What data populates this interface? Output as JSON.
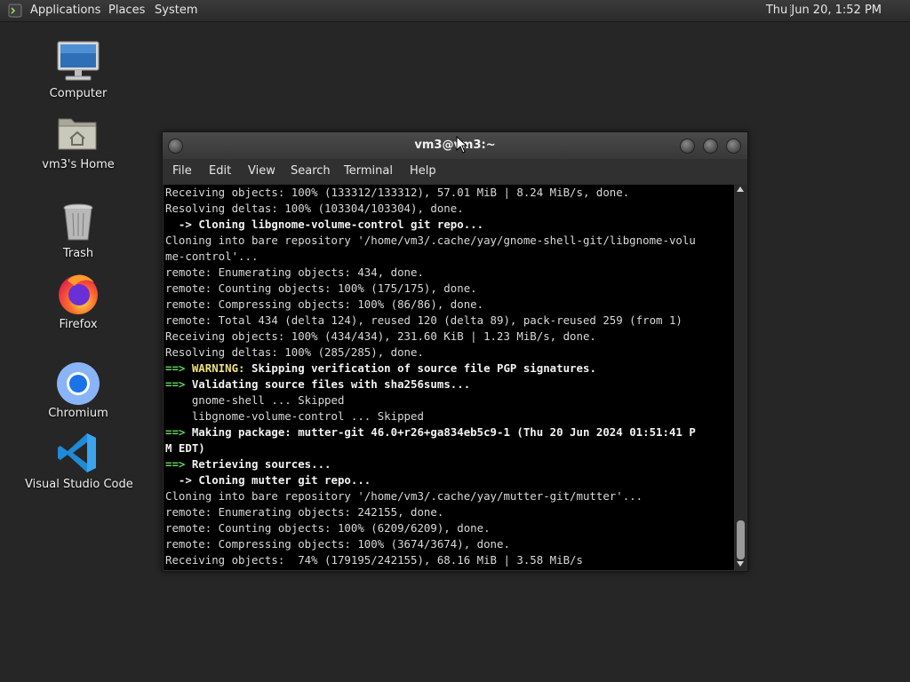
{
  "panel": {
    "applications": "Applications",
    "places": "Places",
    "system": "System",
    "clock": "Thu Jun 20,  1:52 PM"
  },
  "desktop": {
    "icons": [
      {
        "label": "Computer",
        "icon": "computer-icon"
      },
      {
        "label": "vm3's Home",
        "icon": "home-folder-icon"
      },
      {
        "label": "Trash",
        "icon": "trash-icon"
      },
      {
        "label": "Firefox",
        "icon": "firefox-icon"
      },
      {
        "label": "Chromium",
        "icon": "chromium-icon"
      },
      {
        "label": "Visual Studio Code",
        "icon": "vscode-icon"
      }
    ]
  },
  "terminal": {
    "title": "vm3@vm3:~",
    "menu": [
      "File",
      "Edit",
      "View",
      "Search",
      "Terminal",
      "Help"
    ],
    "lines": [
      [
        {
          "t": "Receiving objects: 100% (133312/133312), 57.01 MiB | 8.24 MiB/s, done."
        }
      ],
      [
        {
          "t": "Resolving deltas: 100% (103304/103304), done."
        }
      ],
      [
        {
          "t": "  -> ",
          "c": "bold"
        },
        {
          "t": "Cloning libgnome-volume-control git repo...",
          "c": "bold"
        }
      ],
      [
        {
          "t": "Cloning into bare repository '/home/vm3/.cache/yay/gnome-shell-git/libgnome-volu"
        }
      ],
      [
        {
          "t": "me-control'..."
        }
      ],
      [
        {
          "t": "remote: Enumerating objects: 434, done."
        }
      ],
      [
        {
          "t": "remote: Counting objects: 100% (175/175), done."
        }
      ],
      [
        {
          "t": "remote: Compressing objects: 100% (86/86), done."
        }
      ],
      [
        {
          "t": "remote: Total 434 (delta 124), reused 120 (delta 89), pack-reused 259 (from 1)"
        }
      ],
      [
        {
          "t": "Receiving objects: 100% (434/434), 231.60 KiB | 1.23 MiB/s, done."
        }
      ],
      [
        {
          "t": "Resolving deltas: 100% (285/285), done."
        }
      ],
      [
        {
          "t": "==> ",
          "c": "green"
        },
        {
          "t": "WARNING:",
          "c": "yellow"
        },
        {
          "t": " Skipping verification of source file PGP signatures.",
          "c": "bold"
        }
      ],
      [
        {
          "t": "==> ",
          "c": "green"
        },
        {
          "t": "Validating source files with sha256sums...",
          "c": "bold"
        }
      ],
      [
        {
          "t": "    gnome-shell ... Skipped"
        }
      ],
      [
        {
          "t": "    libgnome-volume-control ... Skipped"
        }
      ],
      [
        {
          "t": "==> ",
          "c": "green"
        },
        {
          "t": "Making package: mutter-git 46.0+r26+ga834eb5c9-1 (Thu 20 Jun 2024 01:51:41 P",
          "c": "bold"
        }
      ],
      [
        {
          "t": "M EDT)",
          "c": "bold"
        }
      ],
      [
        {
          "t": "==> ",
          "c": "green"
        },
        {
          "t": "Retrieving sources...",
          "c": "bold"
        }
      ],
      [
        {
          "t": "  -> ",
          "c": "bold"
        },
        {
          "t": "Cloning mutter git repo...",
          "c": "bold"
        }
      ],
      [
        {
          "t": "Cloning into bare repository '/home/vm3/.cache/yay/mutter-git/mutter'..."
        }
      ],
      [
        {
          "t": "remote: Enumerating objects: 242155, done."
        }
      ],
      [
        {
          "t": "remote: Counting objects: 100% (6209/6209), done."
        }
      ],
      [
        {
          "t": "remote: Compressing objects: 100% (3674/3674), done."
        }
      ],
      [
        {
          "t": "Receiving objects:  74% (179195/242155), 68.16 MiB | 3.58 MiB/s"
        }
      ]
    ]
  }
}
